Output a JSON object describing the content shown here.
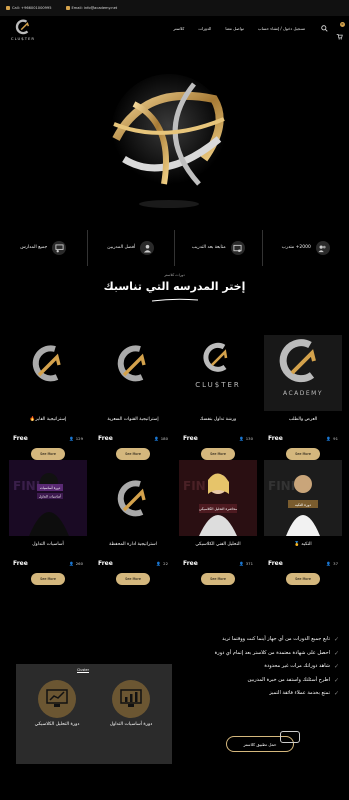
{
  "topbar": {
    "phone": "Call: +966001000995",
    "email": "Email: info@academy.net"
  },
  "brand": {
    "logo_text": "CLU$TER"
  },
  "nav": [
    "تسجيل دخول / إنشاء حساب",
    "تواصل معنا",
    "الدورات",
    "كلاستر"
  ],
  "cart_count": "0",
  "features": [
    {
      "icon": "users-icon",
      "text": "2000+ متدرب"
    },
    {
      "icon": "certificate-icon",
      "text": "متابعة بعد التدريب"
    },
    {
      "icon": "trainer-icon",
      "text": "أفضل المدربين"
    },
    {
      "icon": "teachers-icon",
      "text": "جميع المدارس"
    }
  ],
  "courses_section": {
    "subtitle": "دورات كلاستر",
    "title": "إختر المدرسه التي تناسبك"
  },
  "courses": [
    {
      "title": "العرض والطلب",
      "price": "Free",
      "students": "91",
      "button": "See More",
      "thumb": "academy"
    },
    {
      "title": "ورشة تداول بنفسك",
      "price": "Free",
      "students": "130",
      "button": "See More",
      "thumb": "cluster"
    },
    {
      "title": "إستراتيجية القنوات السعرية",
      "price": "Free",
      "students": "180",
      "button": "See More",
      "thumb": "logo"
    },
    {
      "title": "إستراتيجية الفاير🔥",
      "price": "Free",
      "students": "129",
      "button": "See More",
      "thumb": "logo"
    },
    {
      "title": "التكيه 🥇",
      "price": "Free",
      "students": "37",
      "button": "See More",
      "thumb": "person"
    },
    {
      "title": "التحليل الفني الكلاسيكي",
      "price": "Free",
      "students": "371",
      "button": "See More",
      "thumb": "woman"
    },
    {
      "title": "استراتيجية ادارة المحفظة",
      "price": "Free",
      "students": "22",
      "button": "See More",
      "thumb": "logo"
    },
    {
      "title": "أساسيات التداول",
      "price": "Free",
      "students": "260",
      "button": "See More",
      "thumb": "hooded"
    }
  ],
  "benefits": [
    "تابع جميع الدورات من أي جهاز أينما كنت ووقتما تريد",
    "احصل على شهادة معتمدة من كلاستر بعد إتمام أي دورة",
    "شاهد دوراتك مرات غير محدودة",
    "اطرح أسئلتك واستفد من خبرة المدربين",
    "تمتع بخدمة عملاء فائقة التميز"
  ],
  "promo": {
    "label": "Cluster",
    "left_title": "دورة التحليل الكلاسيكي",
    "right_title": "دورة أساسيات التداول"
  },
  "app_button": "حمل تطبيق كلاستر",
  "colors": {
    "gold": "#d4b77d",
    "accent": "#d4a24c",
    "background": "#000000"
  }
}
